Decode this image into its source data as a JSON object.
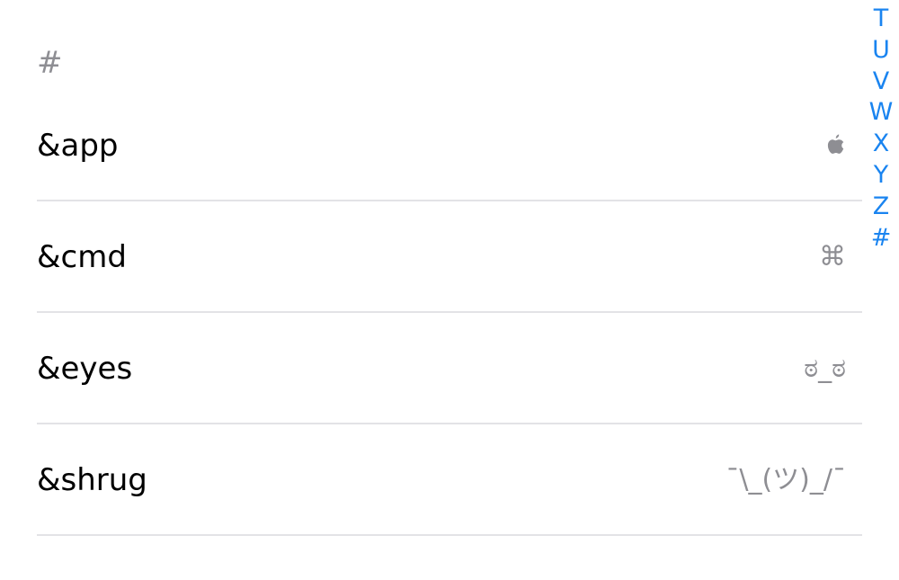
{
  "section": {
    "header": "#"
  },
  "rows": [
    {
      "label": "&app",
      "value": "",
      "icon": "apple-logo-icon"
    },
    {
      "label": "&cmd",
      "value": "⌘"
    },
    {
      "label": "&eyes",
      "value": "ಠ_ಠ"
    },
    {
      "label": "&shrug",
      "value": "¯\\_(ツ)_/¯"
    }
  ],
  "index": {
    "letters": [
      "T",
      "U",
      "V",
      "W",
      "X",
      "Y",
      "Z",
      "#"
    ]
  },
  "colors": {
    "accent": "#1a84f0",
    "secondary_text": "#8e8e93",
    "separator": "#e3e3e6"
  }
}
